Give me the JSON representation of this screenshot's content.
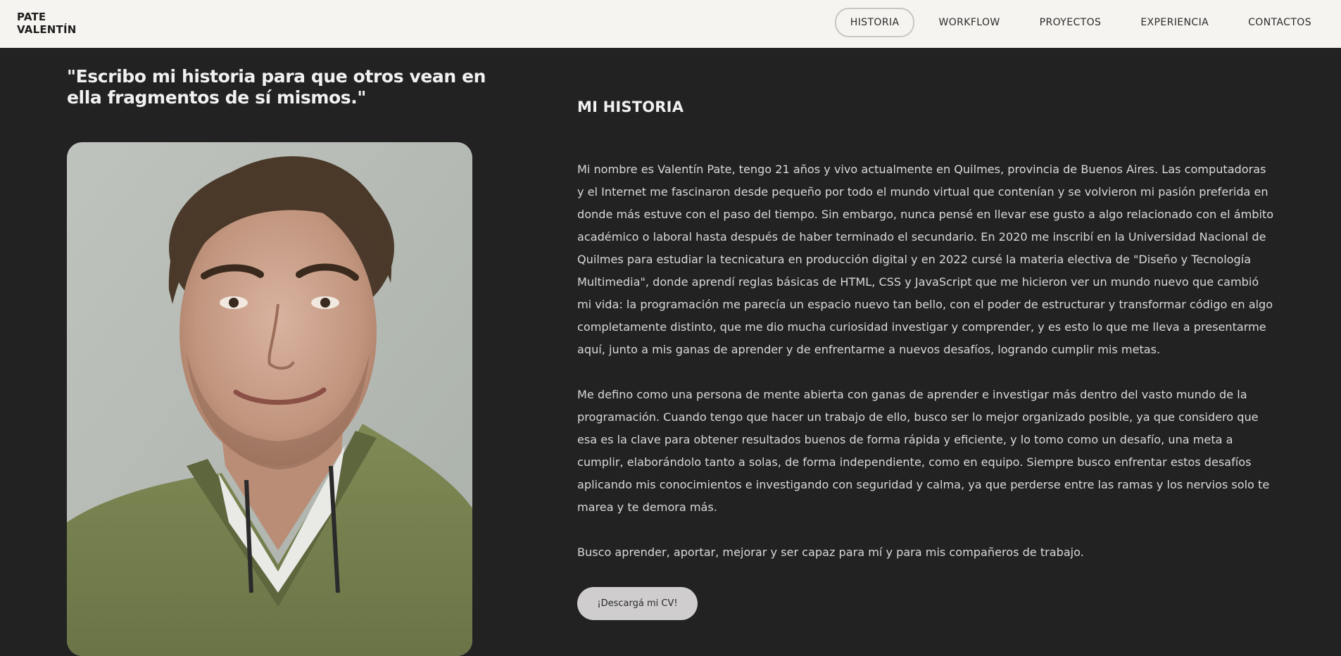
{
  "header": {
    "brand_line1": "PATE",
    "brand_line2": "VALENTÍN",
    "nav": [
      {
        "label": "HISTORIA",
        "active": true
      },
      {
        "label": "WORKFLOW",
        "active": false
      },
      {
        "label": "PROYECTOS",
        "active": false
      },
      {
        "label": "EXPERIENCIA",
        "active": false
      },
      {
        "label": "CONTACTOS",
        "active": false
      }
    ]
  },
  "main": {
    "quote": "\"Escribo mi historia para que otros vean en ella fragmentos de sí mismos.\"",
    "section_title": "MI HISTORIA",
    "paragraphs": [
      "Mi nombre es Valentín Pate, tengo 21 años y vivo actualmente en Quilmes, provincia de Buenos Aires. Las computadoras y el Internet me fascinaron desde pequeño por todo el mundo virtual que contenían y se volvieron mi pasión preferida en donde más estuve con el paso del tiempo. Sin embargo, nunca pensé en llevar ese gusto a algo relacionado con el ámbito académico o laboral hasta después de haber terminado el secundario. En 2020 me inscribí en la Universidad Nacional de Quilmes para estudiar la tecnicatura en producción digital y en 2022 cursé la materia electiva de \"Diseño y Tecnología Multimedia\", donde aprendí reglas básicas de HTML, CSS y JavaScript que me hicieron ver un mundo nuevo que cambió mi vida: la programación me parecía un espacio nuevo tan bello, con el poder de estructurar y transformar código en algo completamente distinto, que me dio mucha curiosidad investigar y comprender, y es esto lo que me lleva a presentarme aquí, junto a mis ganas de aprender y de enfrentarme a nuevos desafíos, logrando cumplir mis metas.",
      "Me defino como una persona de mente abierta con ganas de aprender e investigar más dentro del vasto mundo de la programación. Cuando tengo que hacer un trabajo de ello, busco ser lo mejor organizado posible, ya que considero que esa es la clave para obtener resultados buenos de forma rápida y eficiente, y lo tomo como un desafío, una meta a cumplir, elaborándolo tanto a solas, de forma independiente, como en equipo. Siempre busco enfrentar estos desafíos aplicando mis conocimientos e investigando con seguridad y calma, ya que perderse entre las ramas y los nervios solo te marea y te demora más.",
      "Busco aprender, aportar, mejorar y ser capaz para mí y para mis compañeros de trabajo."
    ],
    "cv_button": "¡Descargá mi CV!"
  }
}
